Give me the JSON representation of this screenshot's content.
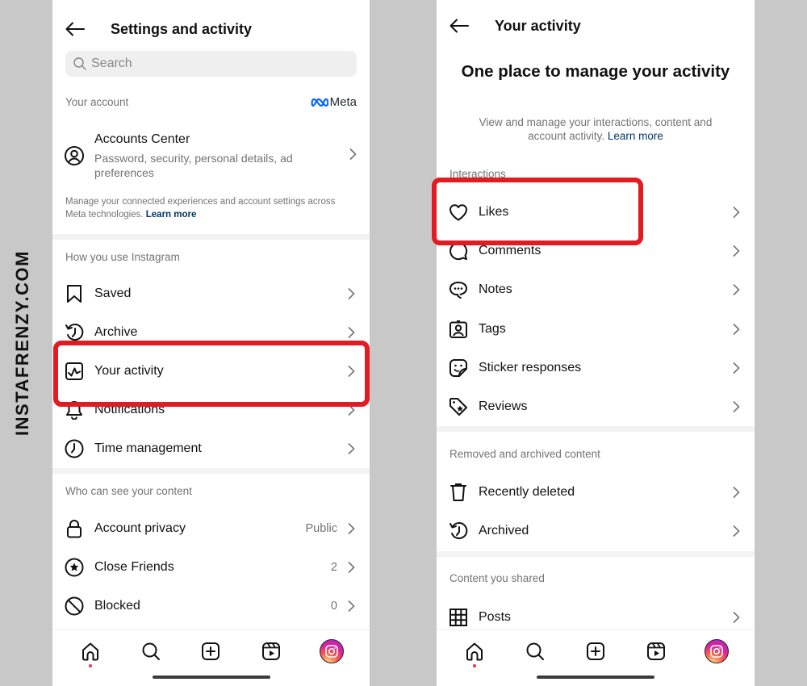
{
  "watermark": "INSTAFRENZY.COM",
  "colors": {
    "highlight": "#e21b23",
    "link": "#00376b",
    "meta_blue": "#0866ff",
    "secondary_text": "#737373",
    "notification_dot": "#ff3040"
  },
  "left_screen": {
    "title": "Settings and activity",
    "back_icon": "arrow-left-icon",
    "search": {
      "placeholder": "Search",
      "value": ""
    },
    "your_account": {
      "label": "Your account",
      "meta_logo": "Meta",
      "accounts_center": {
        "title": "Accounts Center",
        "subtitle": "Password, security, personal details, ad preferences",
        "icon": "user-circle-icon"
      },
      "note": "Manage your connected experiences and account settings across Meta technologies.",
      "note_link": "Learn more"
    },
    "how_you_use": {
      "label": "How you use Instagram",
      "items": [
        {
          "label": "Saved",
          "icon": "bookmark-icon"
        },
        {
          "label": "Archive",
          "icon": "archive-history-icon"
        },
        {
          "label": "Your activity",
          "icon": "activity-icon",
          "highlighted": true
        },
        {
          "label": "Notifications",
          "icon": "bell-icon"
        },
        {
          "label": "Time management",
          "icon": "clock-icon"
        }
      ]
    },
    "who_can_see": {
      "label": "Who can see your content",
      "items": [
        {
          "label": "Account privacy",
          "value": "Public",
          "icon": "lock-icon"
        },
        {
          "label": "Close Friends",
          "value": "2",
          "icon": "star-circle-icon"
        },
        {
          "label": "Blocked",
          "value": "0",
          "icon": "blocked-icon"
        }
      ]
    }
  },
  "right_screen": {
    "title": "Your activity",
    "back_icon": "arrow-left-icon",
    "hero_title": "One place to manage your activity",
    "hero_subtitle": "View and manage your interactions, content and account activity.",
    "hero_link": "Learn more",
    "interactions": {
      "label": "Interactions",
      "items": [
        {
          "label": "Likes",
          "icon": "heart-icon",
          "highlighted": true
        },
        {
          "label": "Comments",
          "icon": "comment-icon"
        },
        {
          "label": "Notes",
          "icon": "notes-icon"
        },
        {
          "label": "Tags",
          "icon": "tag-person-icon"
        },
        {
          "label": "Sticker responses",
          "icon": "sticker-icon"
        },
        {
          "label": "Reviews",
          "icon": "review-tag-icon"
        }
      ]
    },
    "removed_archived": {
      "label": "Removed and archived content",
      "items": [
        {
          "label": "Recently deleted",
          "icon": "trash-icon"
        },
        {
          "label": "Archived",
          "icon": "archive-history-icon"
        }
      ]
    },
    "content_shared": {
      "label": "Content you shared",
      "items": [
        {
          "label": "Posts",
          "icon": "grid-icon"
        }
      ]
    }
  },
  "bottom_nav": [
    {
      "name": "home",
      "icon": "home-icon",
      "has_notification_dot": true
    },
    {
      "name": "search",
      "icon": "search-icon"
    },
    {
      "name": "create",
      "icon": "plus-square-icon"
    },
    {
      "name": "reels",
      "icon": "reels-icon"
    },
    {
      "name": "profile",
      "icon": "profile-avatar-icon"
    }
  ]
}
